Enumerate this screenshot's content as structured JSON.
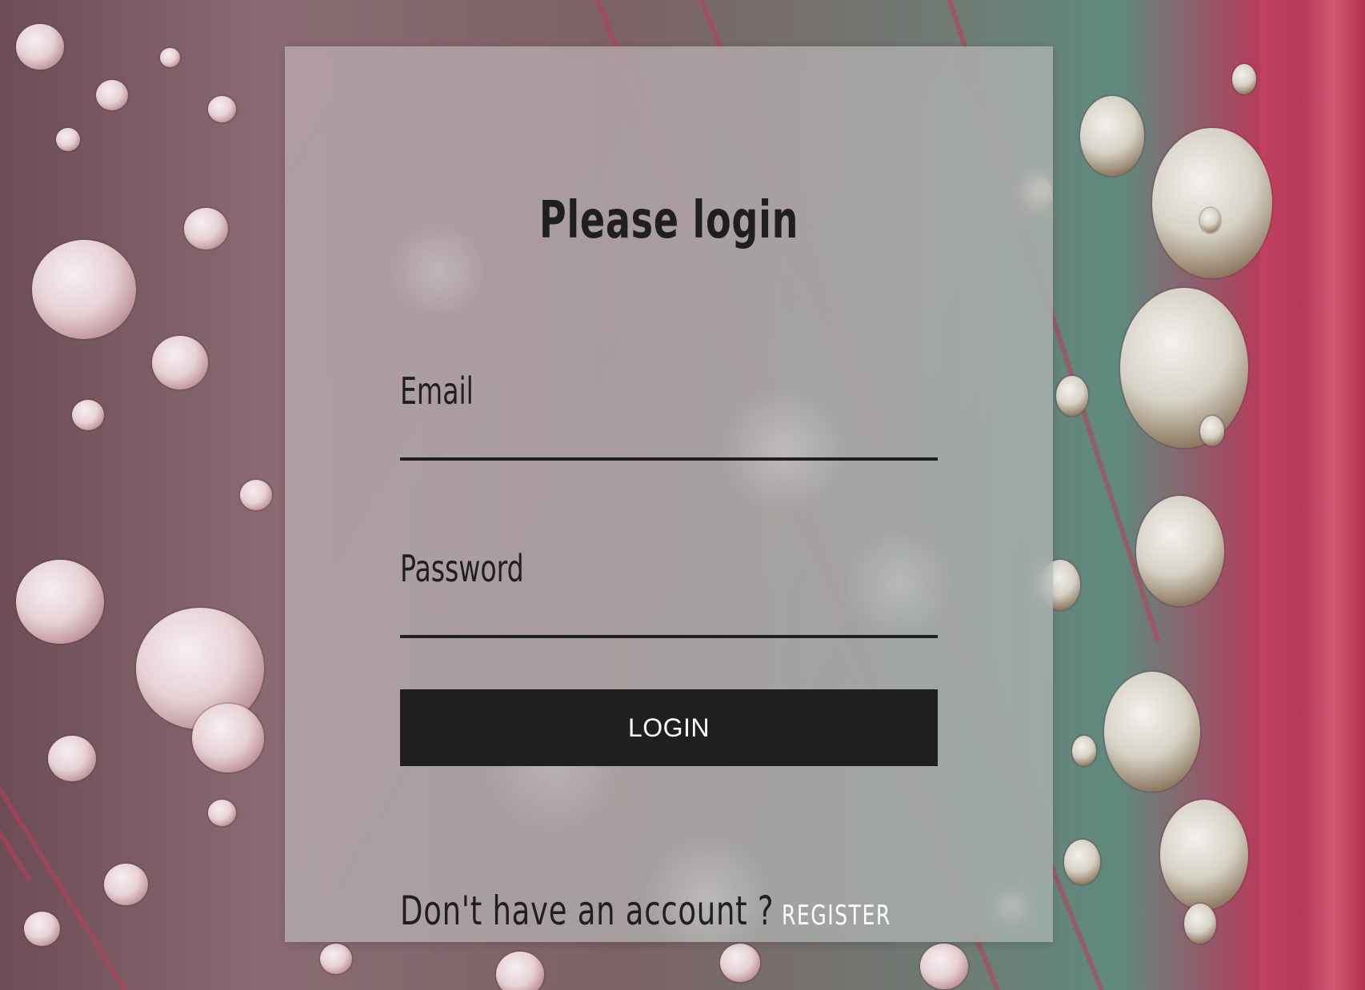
{
  "login": {
    "title": "Please login",
    "email_label": "Email",
    "email_value": "",
    "password_label": "Password",
    "password_value": "",
    "login_button_label": "LOGIN",
    "footer_text": "Don't have an account ?",
    "register_label": "REGISTER"
  },
  "colors": {
    "card_overlay": "#cdc8cb",
    "text_primary": "#1f1f1f",
    "button_background": "#1f1f1f",
    "button_text": "#ffffff",
    "register_link": "#ffffff"
  }
}
